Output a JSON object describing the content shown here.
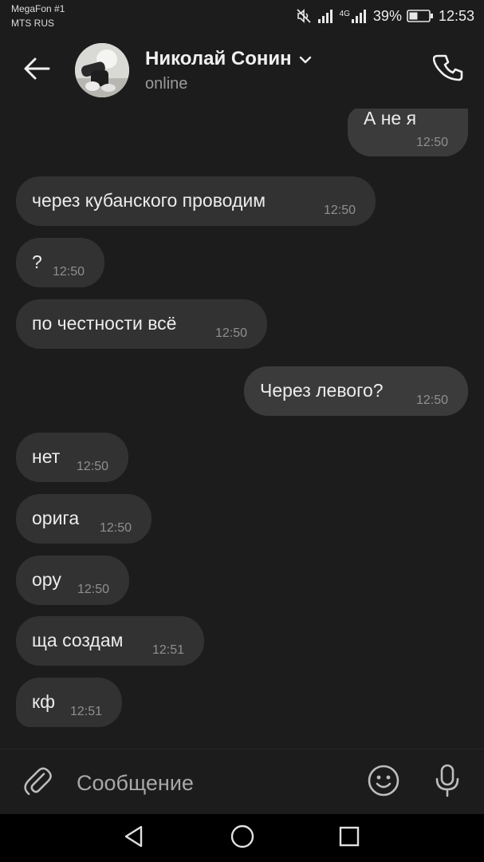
{
  "status_bar": {
    "carrier1": "MegaFon #1",
    "carrier2": "MTS RUS",
    "network_label": "4G",
    "battery": "39%",
    "time": "12:53",
    "icons": [
      "mute-icon",
      "signal-icon",
      "signal-4g-icon",
      "battery-icon"
    ]
  },
  "header": {
    "name": "Николай Сонин",
    "status": "online",
    "icons": [
      "back-arrow-icon",
      "chevron-down-icon",
      "phone-icon"
    ]
  },
  "messages": [
    {
      "direction": "out",
      "text": "А не я",
      "time": "12:50"
    },
    {
      "direction": "in",
      "text": "через кубанского проводим",
      "time": "12:50"
    },
    {
      "direction": "in",
      "text": "?",
      "time": "12:50"
    },
    {
      "direction": "in",
      "text": "по честности всё",
      "time": "12:50"
    },
    {
      "direction": "out",
      "text": "Через левого?",
      "time": "12:50"
    },
    {
      "direction": "in",
      "text": "нет",
      "time": "12:50"
    },
    {
      "direction": "in",
      "text": "орига",
      "time": "12:50"
    },
    {
      "direction": "in",
      "text": "ору",
      "time": "12:50"
    },
    {
      "direction": "in",
      "text": "ща создам",
      "time": "12:51"
    },
    {
      "direction": "in",
      "text": "кф",
      "time": "12:51"
    }
  ],
  "input": {
    "placeholder": "Сообщение",
    "icons": [
      "paperclip-icon",
      "emoji-icon",
      "microphone-icon"
    ]
  },
  "nav": {
    "icons": [
      "nav-back-icon",
      "nav-home-icon",
      "nav-recent-icon"
    ]
  },
  "colors": {
    "background": "#1c1c1c",
    "bubble_in": "#323232",
    "bubble_out": "#3b3b3b",
    "text": "#ececec",
    "time": "#8f8f8f"
  }
}
